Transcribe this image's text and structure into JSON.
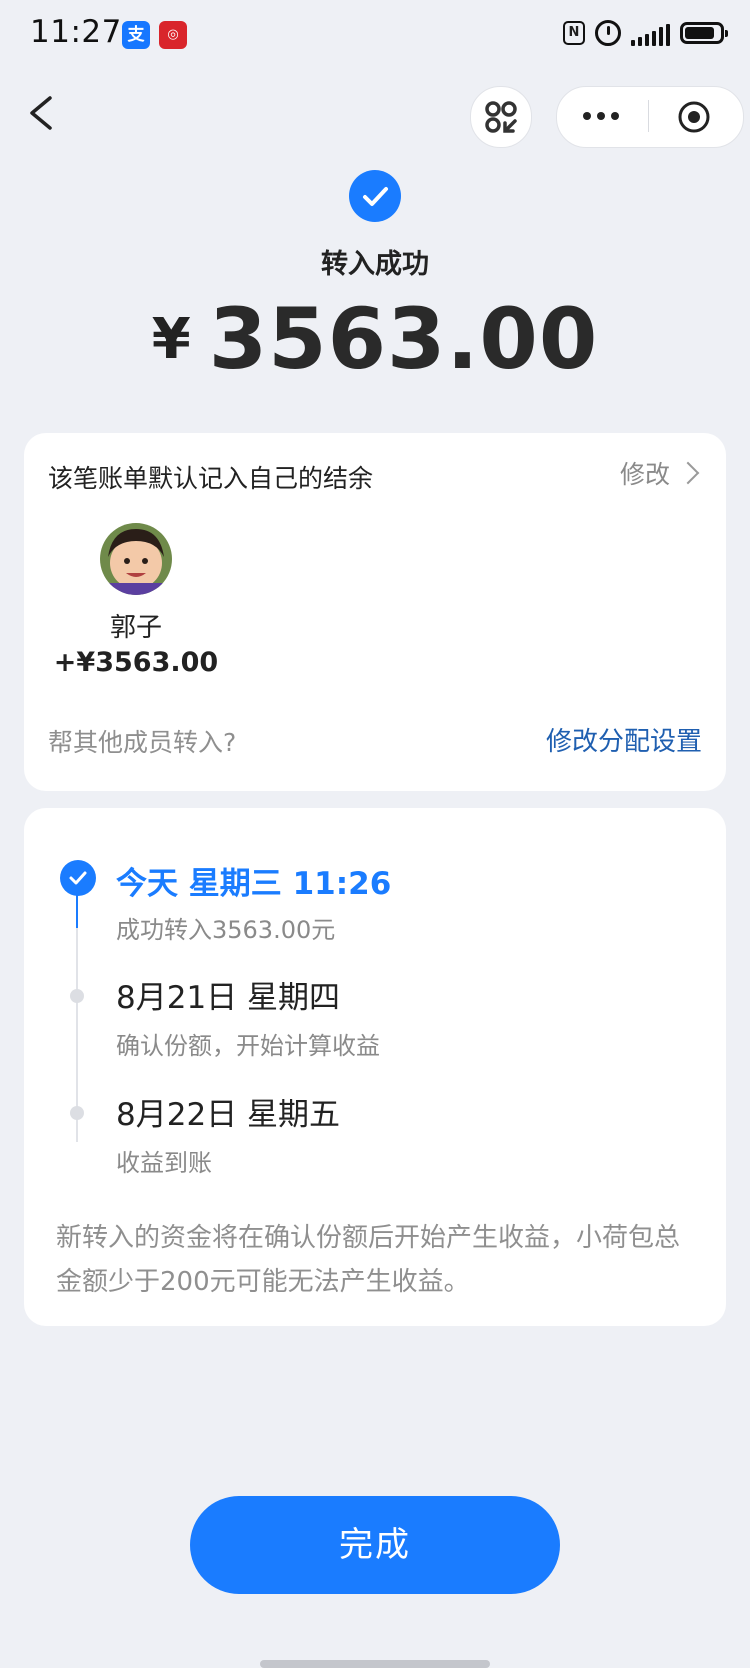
{
  "status_bar": {
    "time": "11:27",
    "alipay_badge": "支",
    "nfc_label": "N"
  },
  "header": {
    "status_title": "转入成功",
    "currency_symbol": "¥",
    "amount": "3563.00"
  },
  "allocation": {
    "description": "该笔账单默认记入自己的结余",
    "modify_label": "修改",
    "member": {
      "name": "郭子",
      "amount": "+¥3563.00"
    },
    "help_text": "帮其他成员转入?",
    "edit_allocation_label": "修改分配设置"
  },
  "timeline": {
    "steps": [
      {
        "title": "今天 星期三 11:26",
        "subtitle": "成功转入3563.00元",
        "state": "done"
      },
      {
        "title": "8月21日 星期四",
        "subtitle": "确认份额，开始计算收益",
        "state": "pending"
      },
      {
        "title": "8月22日 星期五",
        "subtitle": "收益到账",
        "state": "pending"
      }
    ],
    "note": "新转入的资金将在确认份额后开始产生收益，小荷包总金额少于200元可能无法产生收益。"
  },
  "done_button": "完成",
  "colors": {
    "accent": "#1a7cff",
    "link": "#1f5fb0",
    "background": "#eef0f5"
  }
}
